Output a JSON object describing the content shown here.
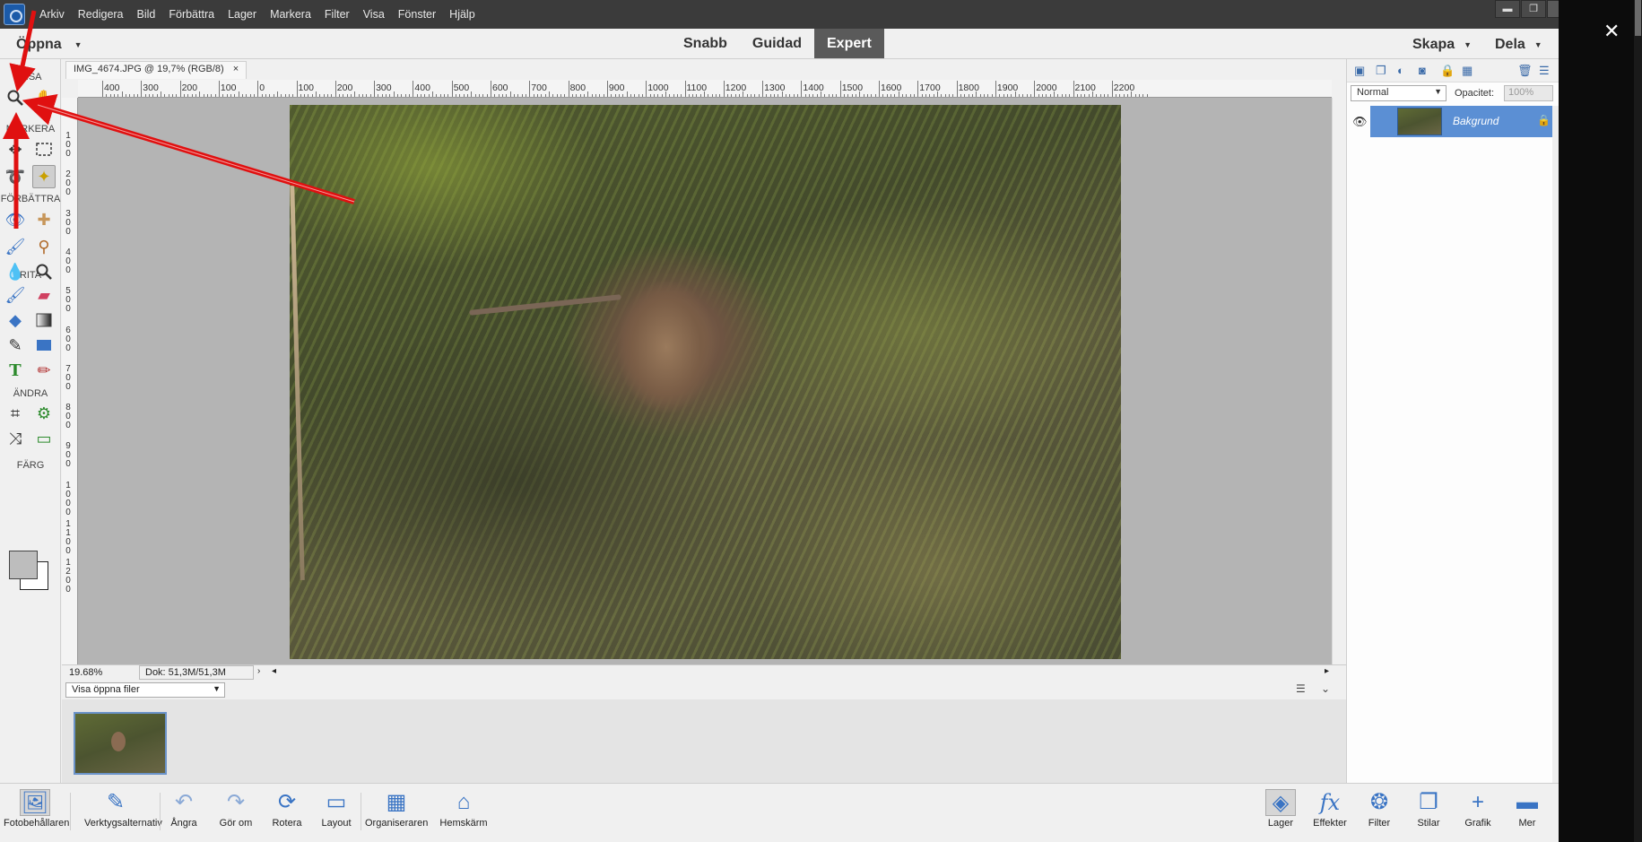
{
  "menubar": {
    "items": [
      "Arkiv",
      "Redigera",
      "Bild",
      "Förbättra",
      "Lager",
      "Markera",
      "Filter",
      "Visa",
      "Fönster",
      "Hjälp"
    ],
    "window_buttons": [
      "▬",
      "❐",
      "✕"
    ]
  },
  "modebar": {
    "open_label": "Öppna",
    "modes": [
      "Snabb",
      "Guidad",
      "Expert"
    ],
    "active_mode": "Expert",
    "create_label": "Skapa",
    "share_label": "Dela"
  },
  "tools": {
    "sections": {
      "view": "VISA",
      "select": "MARKERA",
      "enhance": "FÖRBÄTTRA",
      "draw": "RITA",
      "modify": "ÄNDRA",
      "color": "FÄRG"
    }
  },
  "document": {
    "tab_title": "IMG_4674.JPG @ 19,7% (RGB/8)",
    "tab_close": "×",
    "ruler_h": [
      "400",
      "300",
      "200",
      "100",
      "0",
      "100",
      "200",
      "300",
      "400",
      "500",
      "600",
      "700",
      "800",
      "900",
      "1000",
      "1100",
      "1200",
      "1300",
      "1400",
      "1500",
      "1600",
      "1700",
      "1800",
      "1900",
      "2000",
      "2100",
      "2200"
    ],
    "ruler_v": [
      "100",
      "200",
      "300",
      "400",
      "500",
      "600",
      "700",
      "800",
      "900",
      "1000",
      "1100",
      "1200"
    ],
    "zoom": "19.68%",
    "doc_info": "Dok: 51,3M/51,3M"
  },
  "photobin": {
    "select_value": "Visa öppna filer"
  },
  "layers": {
    "blend_mode": "Normal",
    "opacity_label": "Opacitet:",
    "opacity_value": "100%",
    "layer_name": "Bakgrund"
  },
  "taskbar": {
    "left": [
      "Fotobehållaren",
      "Verktygsalternativ",
      "Ångra",
      "Gör om",
      "Rotera",
      "Layout",
      "Organiseraren",
      "Hemskärm"
    ],
    "right": [
      "Lager",
      "Effekter",
      "Filter",
      "Stilar",
      "Grafik",
      "Mer"
    ]
  },
  "overlay": {
    "close": "✕"
  },
  "colors": {
    "accent": "#5b8fd4",
    "menubar": "#3b3b3b",
    "annotation_arrow": "#e01010"
  }
}
